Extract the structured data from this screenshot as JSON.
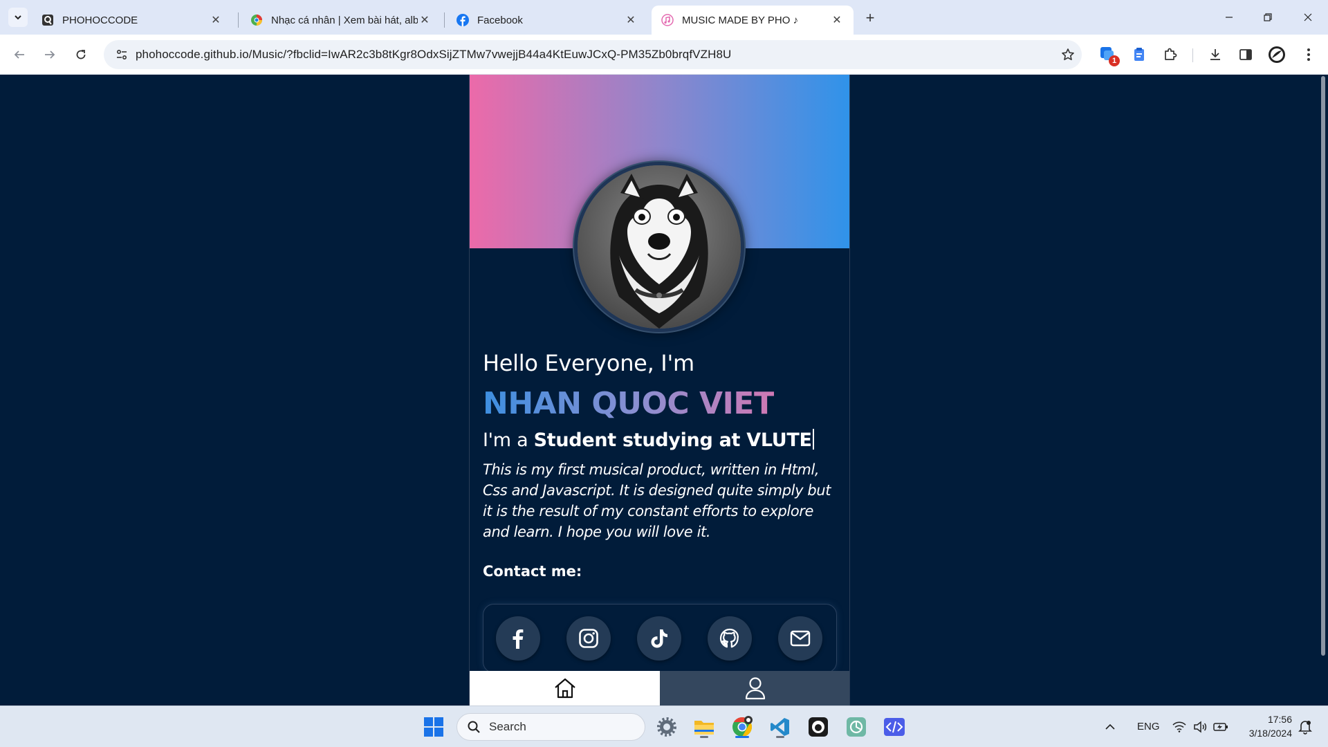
{
  "browser": {
    "tabs": [
      {
        "title": "PHOHOCCODE",
        "active": false
      },
      {
        "title": "Nhạc cá nhân | Xem bài hát, alb",
        "active": false
      },
      {
        "title": "Facebook",
        "active": false
      },
      {
        "title": "MUSIC MADE BY PHO ♪",
        "active": true
      }
    ],
    "url": "phohoccode.github.io/Music/?fbclid=IwAR2c3b8tKgr8OdxSijZTMw7vwejjB44a4KtEuwJCxQ-PM35Zb0brqfVZH8U",
    "extension_badge": "1"
  },
  "profile": {
    "greeting": "Hello Everyone, I'm",
    "name": "NHAN QUOC VIET",
    "role_prefix": "I'm a",
    "role": "Student studying at VLUTE",
    "description": "This is my first musical product, written in Html, Css and Javascript. It is designed quite simply but it is the result of my constant efforts to explore and learn. I hope you will love it.",
    "contact_label": "Contact me:",
    "social_links": [
      "facebook-icon",
      "instagram-icon",
      "tiktok-icon",
      "github-icon",
      "mail-icon"
    ],
    "colors": {
      "banner_start": "#ec6aa9",
      "banner_end": "#2f93ea",
      "background": "#011c3a"
    }
  },
  "bottom_nav": {
    "items": [
      "home-icon",
      "user-icon"
    ],
    "active": "home-icon"
  },
  "taskbar": {
    "search_placeholder": "Search",
    "language": "ENG",
    "time": "17:56",
    "date": "3/18/2024"
  }
}
